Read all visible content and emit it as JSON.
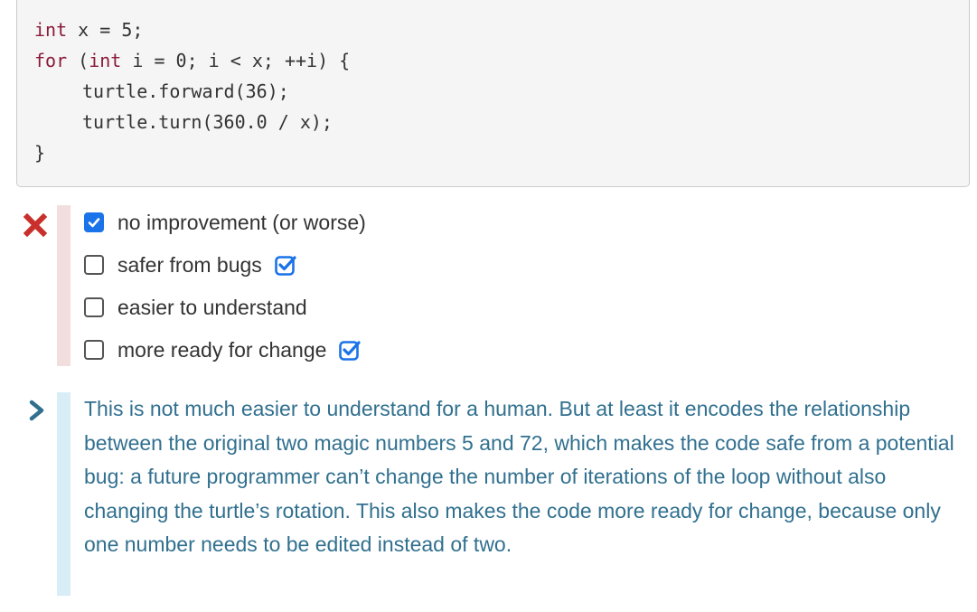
{
  "code": {
    "line1": {
      "kw": "int",
      "rest": " x = 5;"
    },
    "line2": {
      "kw1": "for",
      "mid": " (",
      "kw2": "int",
      "rest": " i = 0; i < x; ++i) {"
    },
    "line3": "turtle.forward(36);",
    "line4": "turtle.turn(360.0 / x);",
    "line5": "}"
  },
  "result": {
    "status": "incorrect",
    "icon": "x-mark-icon",
    "color": "#c9302c"
  },
  "options": [
    {
      "label": "no improvement (or worse)",
      "selected": true,
      "correct": false
    },
    {
      "label": "safer from bugs",
      "selected": false,
      "correct": true
    },
    {
      "label": "easier to understand",
      "selected": false,
      "correct": false
    },
    {
      "label": "more ready for change",
      "selected": false,
      "correct": true
    }
  ],
  "explanation": "This is not much easier to understand for a human. But at least it encodes the relationship between the original two magic numbers 5 and 72, which makes the code safe from a potential bug: a future programmer can’t change the number of iterations of the loop without also changing the turtle’s rotation. This also makes the code more ready for change, because only one number needs to be edited instead of two.",
  "colors": {
    "accent": "#1a73e8",
    "error": "#c9302c",
    "info_text": "#31708f"
  }
}
